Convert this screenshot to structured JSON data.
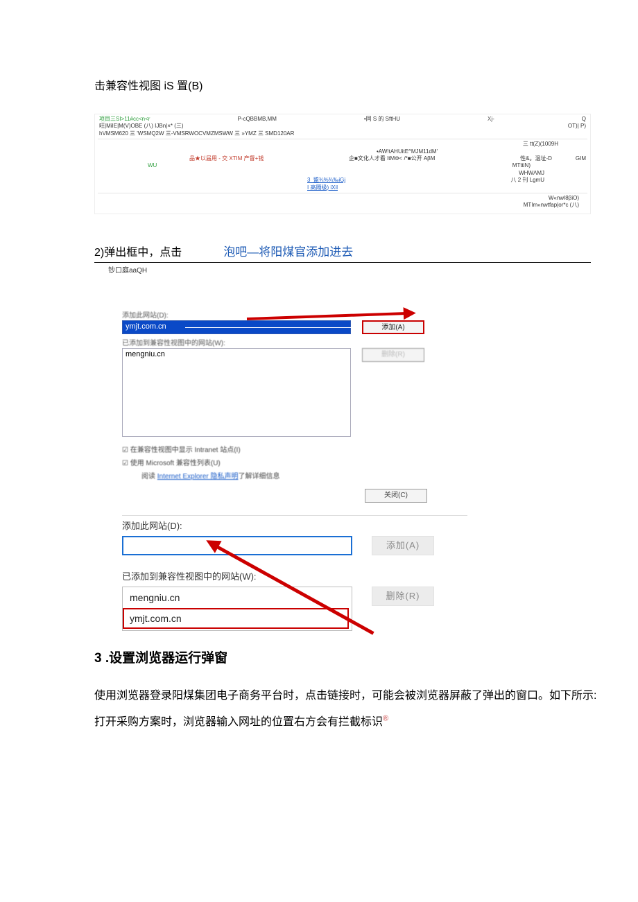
{
  "top_heading": "击兼容性视图 iS 置(B)",
  "frag": {
    "row1": {
      "l1a": "项目三SI>11#cc<n<r",
      "c1": "P-cQBBMB,MM",
      "c2": "•同 S 的 SftHU",
      "c3": "Xj-",
      "r1": "Q"
    },
    "row2": "旺|MiIE|M(V)OBE (八) IJBn|×* (三)",
    "row3": {
      "left": "hVMSM620 三 'WSMQ2W 三-VMSRWOCVMZMSWW 三 »YMZ 三 SMD120AR",
      "right": "OT)| P)"
    },
    "row4_right": "三 tt(Z)(1009H",
    "row5_center": "•AW!tAHUitE^MJM11dM'",
    "row6": {
      "l": "品★以届用 - 交 XTIM 产督+钱",
      "c1": "企■文化人才看 ItMΦ< /*■公开 AβM",
      "r1": "性&。温址-D",
      "r2": "GIM"
    },
    "row7": {
      "wu": "WU",
      "mt": "MTttiN)"
    },
    "row8_r": "WHWΛMJ",
    "row9": {
      "link": "3_盟¾%¾‰iGj",
      "r": "八 2 刊 LgmU"
    },
    "row10_link": "I 高隔级) iXil",
    "row11_r": "W«nwI8βiO)",
    "row12_r": "MTIm«nwtfap|or*c (八)"
  },
  "step2": {
    "text": "2)弹出框中，点击",
    "highlight": "泡吧—将阳煤官添加进去",
    "sub": "钞口庭aaQH"
  },
  "dialog1": {
    "add_label": "添加此网站(D):",
    "add_value": "ymjt.com.cn",
    "add_btn": "添加(A)",
    "list_label": "已添加到兼容性视图中的网站(W):",
    "item1": "mengniu.cn",
    "del_btn": "删除(R)",
    "chk1": "☑ 在兼容性视图中显示 Intranet 站点(I)",
    "chk2": "☑ 使用 Microsoft 兼容性列表(U)",
    "learn_pre": "阅读 ",
    "learn_link": "Internet Explorer 隐私声明",
    "learn_post": "了解详细信息",
    "close_btn": "关闭(C)"
  },
  "dialog2": {
    "add_label": "添加此网站(D):",
    "add_btn": "添加(A)",
    "list_label": "已添加到兼容性视图中的网站(W):",
    "item1": "mengniu.cn",
    "item2": "ymjt.com.cn",
    "del_btn": "删除(R)"
  },
  "sec3": {
    "title": "3 .设置浏览器运行弹窗",
    "p": "使用浏览器登录阳煤集团电子商务平台时，点击链接时，可能会被浏览器屏蔽了弹出的窗口。如下所示:",
    "p2a": "打开采购方案时，浏览器输入网址的位置右方会有拦截标识",
    "p2mark": "®"
  }
}
